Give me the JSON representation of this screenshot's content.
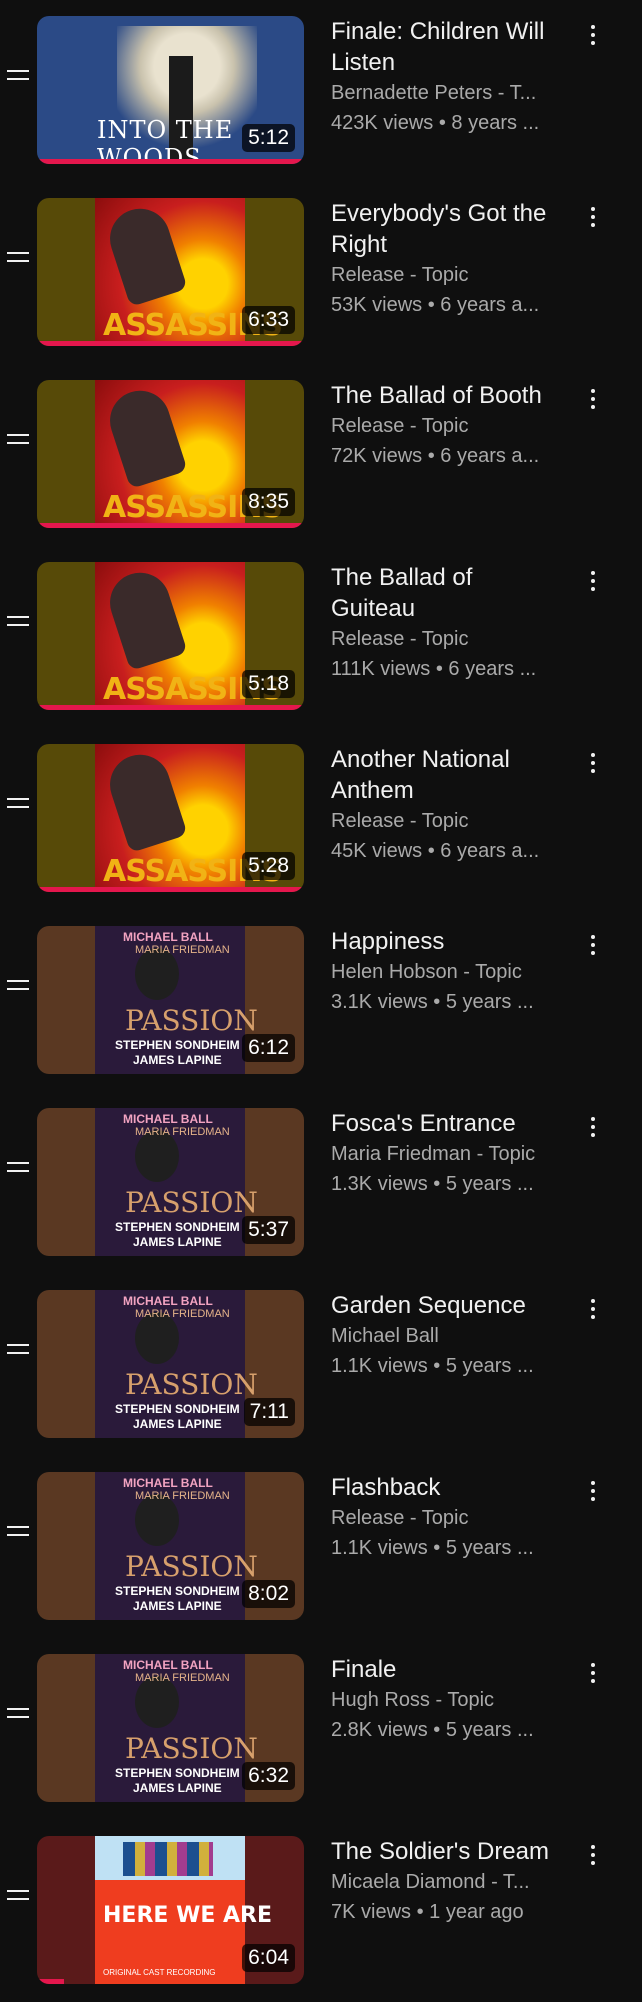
{
  "playlist": [
    {
      "title": "Finale: Children Will Listen",
      "channel": "Bernadette Peters - T...",
      "stats": "423K views • 8 years ...",
      "duration": "5:12",
      "art": "woods",
      "art_text": "INTO THE WOODS",
      "progress": 1.0
    },
    {
      "title": "Everybody's Got the Right",
      "channel": "Release - Topic",
      "stats": "53K views • 6 years a...",
      "duration": "6:33",
      "art": "assassins",
      "art_text": "ASSASSINS",
      "progress": 1.0
    },
    {
      "title": "The Ballad of Booth",
      "channel": "Release - Topic",
      "stats": "72K views • 6 years a...",
      "duration": "8:35",
      "art": "assassins",
      "art_text": "ASSASSINS",
      "progress": 1.0
    },
    {
      "title": "The Ballad of Guiteau",
      "channel": "Release - Topic",
      "stats": "111K views • 6 years ...",
      "duration": "5:18",
      "art": "assassins",
      "art_text": "ASSASSINS",
      "progress": 1.0
    },
    {
      "title": "Another National Anthem",
      "channel": "Release - Topic",
      "stats": "45K views • 6 years a...",
      "duration": "5:28",
      "art": "assassins",
      "art_text": "ASSASSINS",
      "progress": 1.0
    },
    {
      "title": "Happiness",
      "channel": "Helen Hobson - Topic",
      "stats": "3.1K views • 5 years ...",
      "duration": "6:12",
      "art": "passion",
      "art_text": "PASSION",
      "progress": 0
    },
    {
      "title": "Fosca's Entrance",
      "channel": "Maria Friedman - Topic",
      "stats": "1.3K views • 5 years ...",
      "duration": "5:37",
      "art": "passion",
      "art_text": "PASSION",
      "progress": 0
    },
    {
      "title": "Garden Sequence",
      "channel": "Michael Ball",
      "stats": "1.1K views • 5 years ...",
      "duration": "7:11",
      "art": "passion",
      "art_text": "PASSION",
      "progress": 0
    },
    {
      "title": "Flashback",
      "channel": "Release - Topic",
      "stats": "1.1K views • 5 years ...",
      "duration": "8:02",
      "art": "passion",
      "art_text": "PASSION",
      "progress": 0
    },
    {
      "title": "Finale",
      "channel": "Hugh Ross - Topic",
      "stats": "2.8K views • 5 years ...",
      "duration": "6:32",
      "art": "passion",
      "art_text": "PASSION",
      "progress": 0
    },
    {
      "title": "The Soldier's Dream",
      "channel": "Micaela Diamond - T...",
      "stats": "7K views • 1 year ago",
      "duration": "6:04",
      "art": "here",
      "art_text": "HERE WE ARE",
      "progress": 0.1
    }
  ],
  "passion_credits": {
    "top": "MICHAEL BALL",
    "mid": "MARIA FRIEDMAN",
    "l3": "STEPHEN SONDHEIM",
    "l4": "JAMES LAPINE"
  },
  "here_sub": "ORIGINAL CAST RECORDING"
}
